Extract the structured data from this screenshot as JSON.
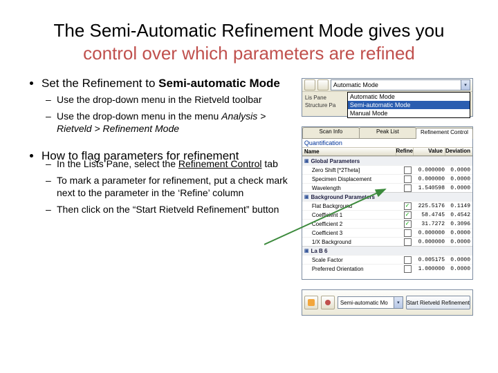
{
  "title": {
    "line1": "The Semi-Automatic Refinement Mode gives you",
    "line2": "control over which parameters are refined"
  },
  "bullets": {
    "b1": "Set the Refinement to ",
    "b1_bold": "Semi-automatic Mode",
    "b1_sub1": "Use the drop-down menu in the Rietveld toolbar",
    "b1_sub2_a": "Use the drop-down menu in the menu ",
    "b1_sub2_b": "Analysis > Rietveld > Refinement Mode",
    "b2": "How to flag parameters for refinement",
    "b2_sub1_a": "In the Lists Pane, select the ",
    "b2_sub1_b": "Refinement Control",
    "b2_sub1_c": " tab",
    "b2_sub2": "To mark a parameter for refinement, put a check mark next to the parameter in the ‘Refine’ column",
    "b2_sub3": "Then click on the “Start Rietveld Refinement” button"
  },
  "shot1": {
    "combo_value": "Automatic Mode",
    "left1": "Lis Pane",
    "left2": "Structure Pa",
    "opt1": "Automatic Mode",
    "opt2": "Semi-automatic Mode",
    "opt3": "Manual Mode"
  },
  "shot2": {
    "tab1": "Scan Info",
    "tab2": "Peak List",
    "tab3": "Refinement Control",
    "quant": "Quantification",
    "col_name": "Name",
    "col_refine": "Refine",
    "col_value": "Value",
    "col_dev": "Deviation",
    "grp_global": "Global Parameters",
    "rows_global": [
      {
        "name": "Zero Shift [*2Theta]",
        "refine": false,
        "value": "0.000000",
        "dev": "0.0000"
      },
      {
        "name": "Specimen Displacement",
        "refine": false,
        "value": "0.000000",
        "dev": "0.0000"
      },
      {
        "name": "Wavelength",
        "refine": false,
        "value": "1.540598",
        "dev": "0.0000"
      }
    ],
    "grp_bg": "Background Parameters",
    "rows_bg": [
      {
        "name": "Flat Background",
        "refine": true,
        "value": "225.5176",
        "dev": "0.1149"
      },
      {
        "name": "Coefficient 1",
        "refine": true,
        "value": "58.4745",
        "dev": "0.4542"
      },
      {
        "name": "Coefficient 2",
        "refine": true,
        "value": "31.7272",
        "dev": "0.3096"
      },
      {
        "name": "Coefficient 3",
        "refine": false,
        "value": "0.000000",
        "dev": "0.0000"
      },
      {
        "name": "1/X Background",
        "refine": false,
        "value": "0.000000",
        "dev": "0.0000"
      }
    ],
    "grp_phase": "La B 6",
    "rows_phase": [
      {
        "name": "Scale Factor",
        "refine": false,
        "value": "0.005175",
        "dev": "0.0000"
      },
      {
        "name": "Preferred Orientation",
        "refine": false,
        "value": "1.000000",
        "dev": "0.0000"
      }
    ]
  },
  "shot3": {
    "combo": "Semi-automatic Mo",
    "button": "Start Rietveld Refinement"
  }
}
